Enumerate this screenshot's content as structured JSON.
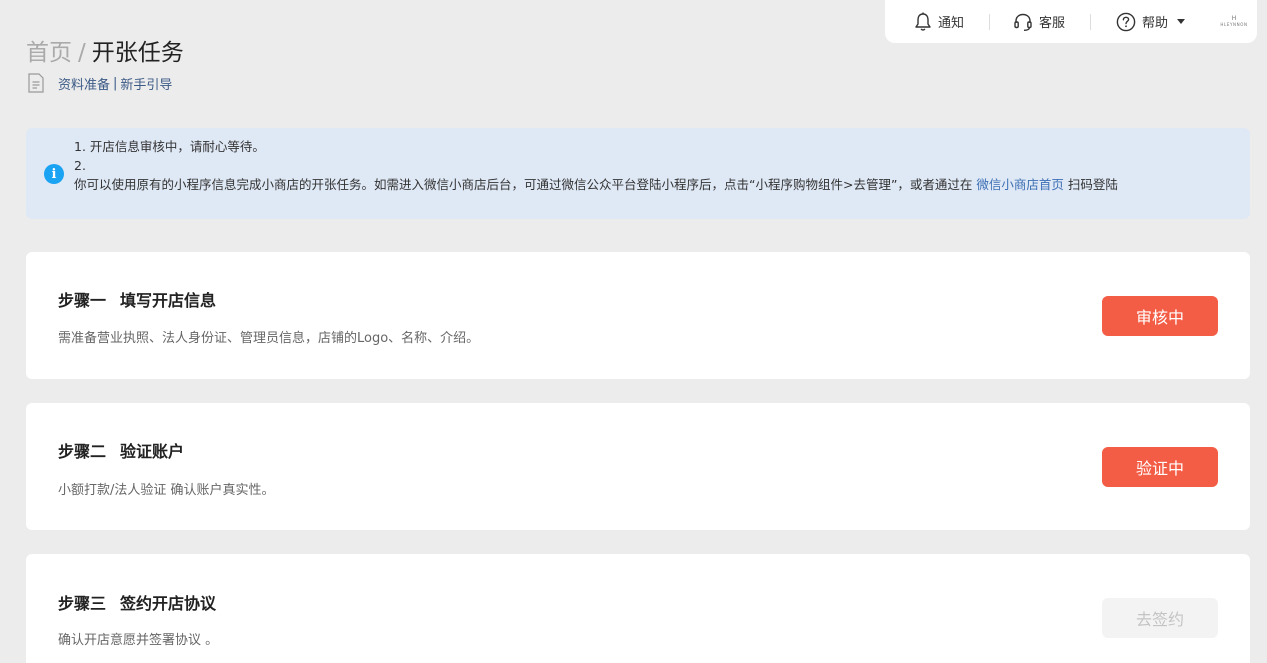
{
  "topbar": {
    "notify_label": "通知",
    "service_label": "客服",
    "help_label": "帮助",
    "logo_mark": "H",
    "logo_text": "HLEYNNON"
  },
  "breadcrumb": {
    "home": "首页",
    "separator": "/",
    "current": "开张任务"
  },
  "subnav": {
    "materials": "资料准备",
    "separator": "|",
    "guide": "新手引导"
  },
  "notice": {
    "line1": "1. 开店信息审核中，请耐心等待。",
    "line2": "2.",
    "line3_prefix": "你可以使用原有的小程序信息完成小商店的开张任务。如需进入微信小商店后台，可通过微信公众平台登陆小程序后，点击“小程序购物组件>去管理”，或者通过在",
    "line3_link": "微信小商店首页",
    "line3_suffix": "扫码登陆"
  },
  "steps": [
    {
      "step": "步骤一",
      "title": "填写开店信息",
      "desc": "需准备营业执照、法人身份证、管理员信息，店铺的Logo、名称、介绍。",
      "button": "审核中",
      "state": "active"
    },
    {
      "step": "步骤二",
      "title": "验证账户",
      "desc": "小额打款/法人验证 确认账户真实性。",
      "button": "验证中",
      "state": "active"
    },
    {
      "step": "步骤三",
      "title": "签约开店协议",
      "desc": "确认开店意愿并签署协议 。",
      "button": "去签约",
      "state": "disabled"
    }
  ],
  "colors": {
    "accent": "#f45d45",
    "info": "#1aa2f3",
    "link": "#3c5a86",
    "notice_bg": "#dfe8f5",
    "page_bg": "#ececec"
  }
}
